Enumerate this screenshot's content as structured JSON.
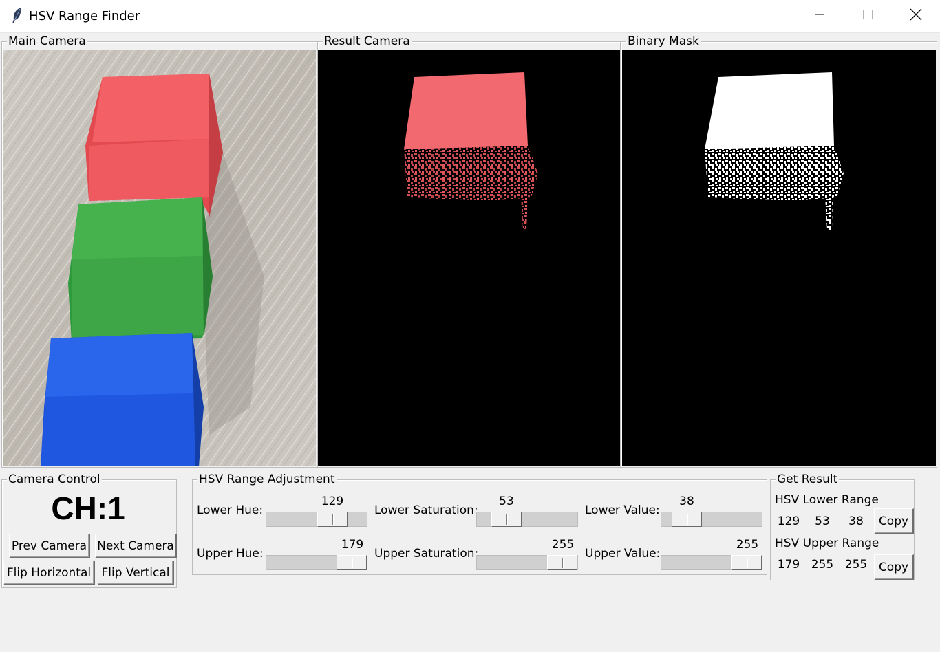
{
  "window": {
    "title": "HSV Range Finder",
    "app_icon": "feather-icon",
    "controls": [
      "minimize-icon",
      "maximize-icon",
      "close-icon"
    ]
  },
  "frames": {
    "main_camera": "Main Camera",
    "result_camera": "Result Camera",
    "binary_mask": "Binary Mask"
  },
  "camera_control": {
    "title": "Camera Control",
    "channel": "CH:1",
    "prev_label": "Prev Camera",
    "next_label": "Next Camera",
    "flip_h_label": "Flip Horizontal",
    "flip_v_label": "Flip Vertical"
  },
  "hsv_adjust": {
    "title": "HSV Range Adjustment",
    "sliders": [
      {
        "label": "Lower Hue:",
        "value": "129",
        "max": 179
      },
      {
        "label": "Lower Saturation:",
        "value": "53",
        "max": 255
      },
      {
        "label": "Lower Value:",
        "value": "38",
        "max": 255
      },
      {
        "label": "Upper Hue:",
        "value": "179",
        "max": 179
      },
      {
        "label": "Upper Saturation:",
        "value": "255",
        "max": 255
      },
      {
        "label": "Upper Value:",
        "value": "255",
        "max": 255
      }
    ]
  },
  "get_result": {
    "title": "Get Result",
    "lower_label": "HSV Lower Range",
    "lower": [
      "129",
      "53",
      "38"
    ],
    "upper_label": "HSV Upper Range",
    "upper": [
      "179",
      "255",
      "255"
    ],
    "copy_label": "Copy"
  },
  "colors": {
    "background": "#f0f0f0",
    "red_cube": "#f05a5c",
    "green_cube": "#3fa946",
    "blue_cube": "#1f5fe6",
    "mask_white": "#ffffff",
    "mask_black": "#000000"
  }
}
